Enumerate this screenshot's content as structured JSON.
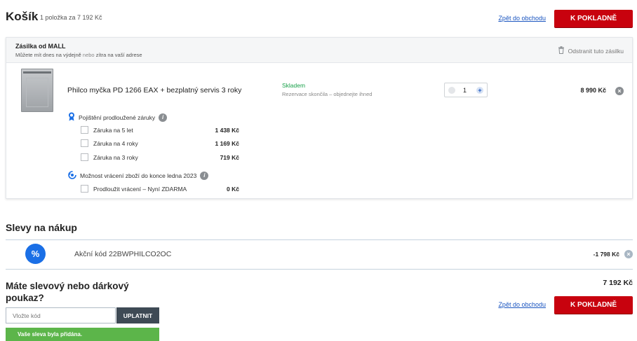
{
  "header": {
    "title": "Košík",
    "subtitle": "1 položka za 7 192 Kč",
    "back_link": "Zpět do obchodu",
    "checkout_button": "K POKLADNĚ"
  },
  "shipment": {
    "title": "Zásilka od MALL",
    "note_prefix": "Můžete mít dnes na výdejně",
    "note_or": "nebo",
    "note_suffix": "zítra na vaší adrese",
    "remove_label": "Odstranit tuto zásilku",
    "item": {
      "name": "Philco myčka PD 1266 EAX + bezplatný servis 3 roky",
      "stock": "Skladem",
      "reservation": "Rezervace skončila – objednejte ihned",
      "quantity": "1",
      "price": "8 990 Kč"
    },
    "warranty": {
      "label": "Pojištění prodloužené záruky",
      "options": [
        {
          "label": "Záruka na 5 let",
          "price": "1 438 Kč"
        },
        {
          "label": "Záruka na 4 roky",
          "price": "1 169 Kč"
        },
        {
          "label": "Záruka na 3 roky",
          "price": "719 Kč"
        }
      ]
    },
    "returns": {
      "label": "Možnost vrácení zboží do konce ledna 2023",
      "options": [
        {
          "label": "Prodloužit vrácení – Nyní ZDARMA",
          "price": "0 Kč"
        }
      ]
    }
  },
  "discounts": {
    "title": "Slevy na nákup",
    "code_label": "Akční kód 22BWPHILCO2OC",
    "code_amount": "-1 798 Kč"
  },
  "voucher": {
    "title": "Máte slevový nebo dárkový poukaz?",
    "placeholder": "Vložte kód",
    "apply_button": "UPLATNIT",
    "success": "Vaše sleva byla přidána."
  },
  "summary": {
    "total": "7 192 Kč",
    "back_link": "Zpět do obchodu",
    "checkout_button": "K POKLADNĚ"
  },
  "colors": {
    "accent_red": "#c8020e",
    "link_blue": "#1a55c0",
    "stock_green": "#19a14a",
    "success_green": "#5cb54a",
    "discount_blue": "#1a6fe6"
  }
}
